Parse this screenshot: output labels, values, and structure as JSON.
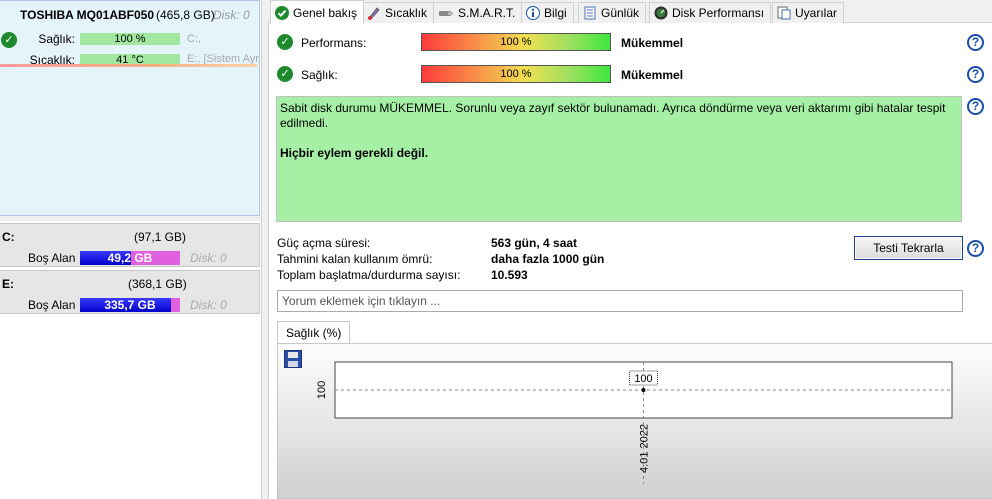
{
  "disk": {
    "model": "TOSHIBA MQ01ABF050",
    "size": "(465,8 GB)",
    "disk_num": "Disk: 0",
    "health_label": "Sağlık:",
    "health_value": "100 %",
    "health_vol": "C:,",
    "temp_label": "Sıcaklık:",
    "temp_value": "41 °C",
    "temp_vol": "E:,  [Sistem Ayrıldı]"
  },
  "partitions": [
    {
      "letter": "C:",
      "size": "(97,1 GB)",
      "free_label": "Boş Alan",
      "free_value": "49,2 GB",
      "free_fraction": 0.507,
      "disk": "Disk: 0"
    },
    {
      "letter": "E:",
      "size": "(368,1 GB)",
      "free_label": "Boş Alan",
      "free_value": "335,7 GB",
      "free_fraction": 0.912,
      "disk": "Disk: 0"
    }
  ],
  "tabs": [
    {
      "label": "Genel bakış",
      "icon": "check-icon",
      "active": true
    },
    {
      "label": "Sıcaklık",
      "icon": "thermometer-icon"
    },
    {
      "label": "S.M.A.R.T.",
      "icon": "smart-icon"
    },
    {
      "label": "Bilgi",
      "icon": "info-icon"
    },
    {
      "label": "Günlük",
      "icon": "log-icon"
    },
    {
      "label": "Disk Performansı",
      "icon": "performance-icon"
    },
    {
      "label": "Uyarılar",
      "icon": "alerts-icon"
    }
  ],
  "overview": {
    "performance_label": "Performans:",
    "performance_value": "100 %",
    "performance_result": "Mükemmel",
    "health_label": "Sağlık:",
    "health_value": "100 %",
    "health_result": "Mükemmel",
    "status_text": "Sabit disk durumu MÜKEMMEL. Sorunlu veya zayıf sektör bulunamadı. Ayrıca döndürme veya veri aktarımı gibi hatalar tespit edilmedi.",
    "status_action": "Hiçbir eylem gerekli değil."
  },
  "stats": {
    "power_on_label": "Güç açma süresi:",
    "power_on_value": "563 gün, 4 saat",
    "remaining_label": "Tahmini kalan kullanım ömrü:",
    "remaining_value": "daha fazla 1000 gün",
    "startstop_label": "Toplam başlatma/durdurma sayısı:",
    "startstop_value": "10.593"
  },
  "retest_button": "Testi Tekrarla",
  "comment_placeholder": "Yorum eklemek için tıklayın ...",
  "chart_tab": "Sağlık (%)",
  "chart_data": {
    "type": "line",
    "title": "",
    "x": [
      "4.01 2022"
    ],
    "series": [
      {
        "values": [
          100
        ]
      }
    ],
    "ytick_labels": [
      "100"
    ],
    "data_labels": [
      "100"
    ],
    "ylim": [
      0,
      200
    ],
    "grid": true
  },
  "colors": {
    "ok_green": "#1f8a2d",
    "status_bg": "#a6f0a6",
    "selected_disk_bg": "#e5f3fb",
    "help_blue": "#1a4fa8"
  }
}
